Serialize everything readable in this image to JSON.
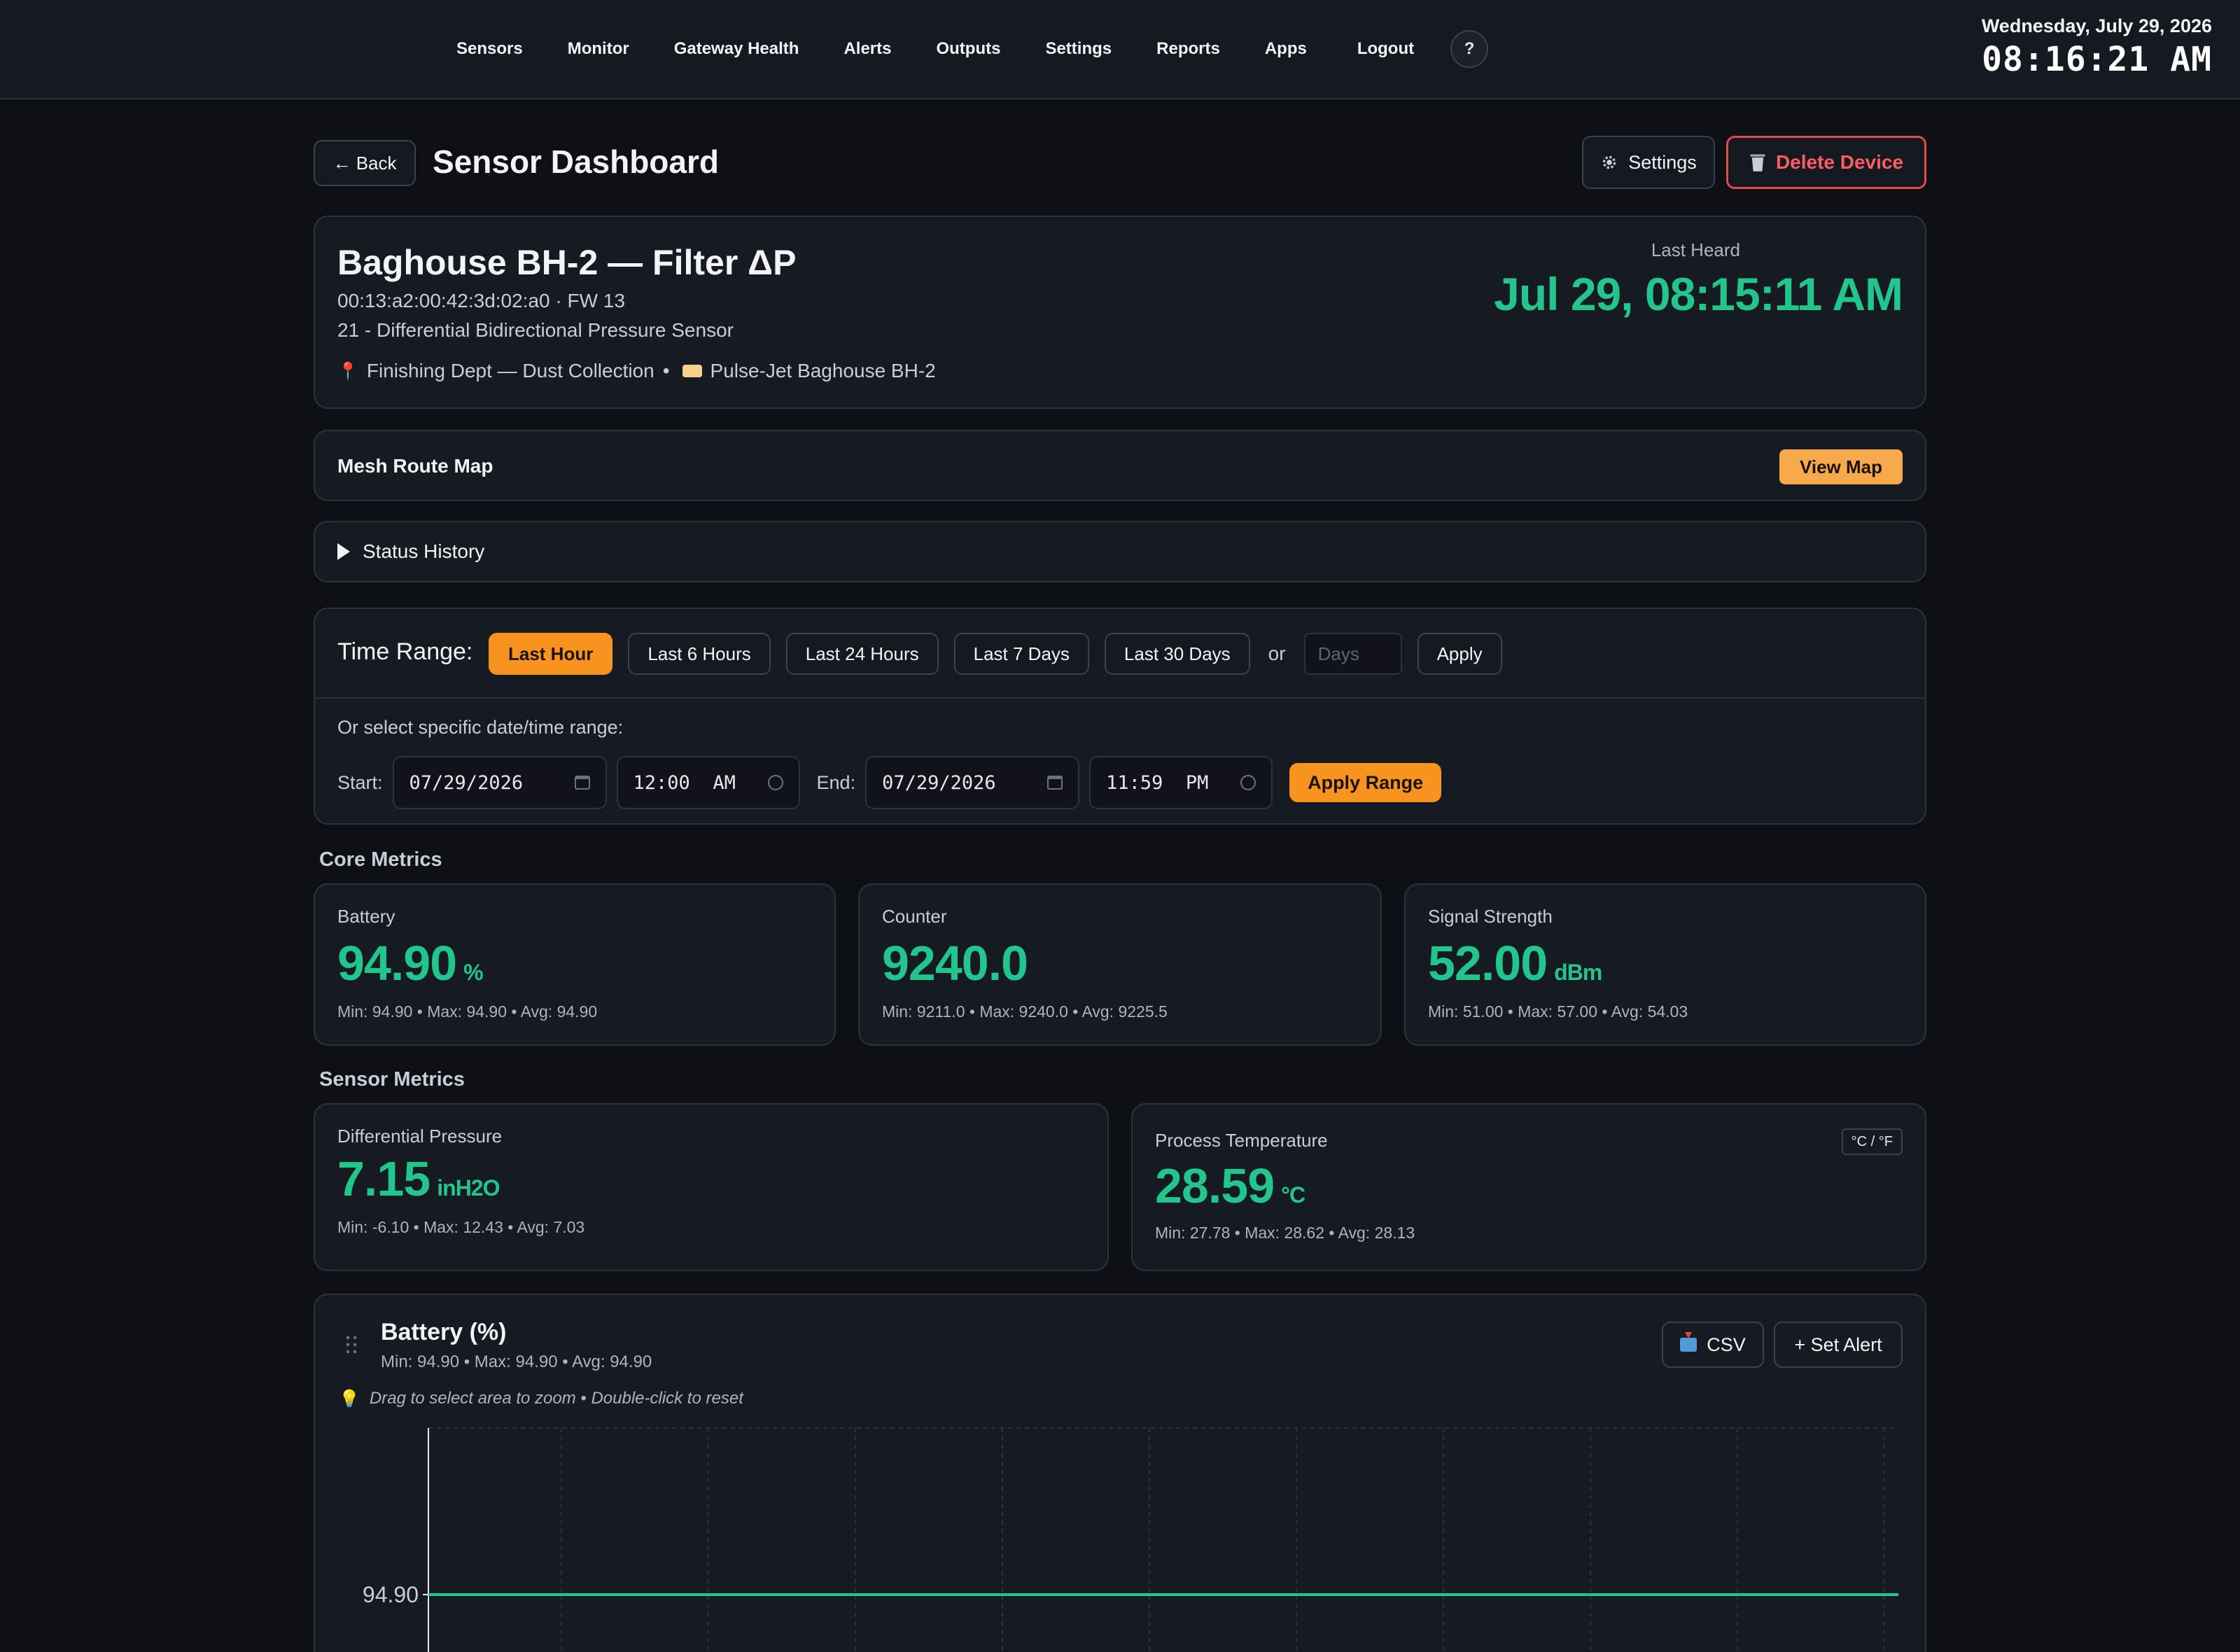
{
  "nav": {
    "items": [
      "Sensors",
      "Monitor",
      "Gateway Health",
      "Alerts",
      "Outputs",
      "Settings",
      "Reports",
      "Apps",
      "Logout"
    ],
    "help_label": "?"
  },
  "clock": {
    "date": "Wednesday, July 29, 2026",
    "time": "08:16:21 AM"
  },
  "header": {
    "back_label": "← Back",
    "title": "Sensor Dashboard",
    "settings_label": "Settings",
    "settings_icon": "gear-icon",
    "delete_label": "Delete Device",
    "delete_icon": "trash-icon"
  },
  "device": {
    "name": "Baghouse BH-2 — Filter ΔP",
    "mac_fw": "00:13:a2:00:42:3d:02:a0 · FW 13",
    "type": "21 - Differential Bidirectional Pressure Sensor",
    "location": "Finishing Dept — Dust Collection",
    "location_separator": "•",
    "asset": "Pulse-Jet Baghouse BH-2",
    "last_heard_label": "Last Heard",
    "last_heard": "Jul 29, 08:15:11 AM"
  },
  "mesh": {
    "title": "Mesh Route Map",
    "button": "View Map"
  },
  "status_history": {
    "label": "Status History"
  },
  "time_range": {
    "label": "Time Range:",
    "options": [
      "Last Hour",
      "Last 6 Hours",
      "Last 24 Hours",
      "Last 7 Days",
      "Last 30 Days"
    ],
    "active": "Last Hour",
    "or_label": "or",
    "days_placeholder": "Days",
    "apply_label": "Apply",
    "specific_label": "Or select specific date/time range:",
    "start_label": "Start:",
    "start_date": "07/29/2026",
    "start_time": "12:00  AM",
    "end_label": "End:",
    "end_date": "07/29/2026",
    "end_time": "11:59  PM",
    "apply_range_label": "Apply Range"
  },
  "core_metrics": {
    "title": "Core Metrics",
    "cards": [
      {
        "label": "Battery",
        "value": "94.90",
        "unit": "%",
        "stats": "Min: 94.90 • Max: 94.90 • Avg: 94.90"
      },
      {
        "label": "Counter",
        "value": "9240.0",
        "unit": "",
        "stats": "Min: 9211.0 • Max: 9240.0 • Avg: 9225.5"
      },
      {
        "label": "Signal Strength",
        "value": "52.00",
        "unit": "dBm",
        "stats": "Min: 51.00 • Max: 57.00 • Avg: 54.03"
      }
    ]
  },
  "sensor_metrics": {
    "title": "Sensor Metrics",
    "cards": [
      {
        "label": "Differential Pressure",
        "value": "7.15",
        "unit": "inH2O",
        "stats": "Min: -6.10 • Max: 12.43 • Avg: 7.03"
      },
      {
        "label": "Process Temperature",
        "value": "28.59",
        "unit": "°C",
        "stats": "Min: 27.78 • Max: 28.62 • Avg: 28.13",
        "toggle": "°C / °F"
      }
    ]
  },
  "battery_chart": {
    "title": "Battery (%)",
    "stats": "Min: 94.90 • Max: 94.90 • Avg: 94.90",
    "hint": "Drag to select area to zoom • Double-click to reset",
    "csv_label": "CSV",
    "set_alert_label": "+ Set Alert",
    "line_color": "#22c58b"
  },
  "chart_data": {
    "type": "line",
    "title": "Battery (%)",
    "xlabel": "",
    "ylabel": "",
    "y_ticks": [
      "94.90"
    ],
    "series": [
      {
        "values": [
          94.9,
          94.9
        ]
      }
    ],
    "grid": true
  }
}
